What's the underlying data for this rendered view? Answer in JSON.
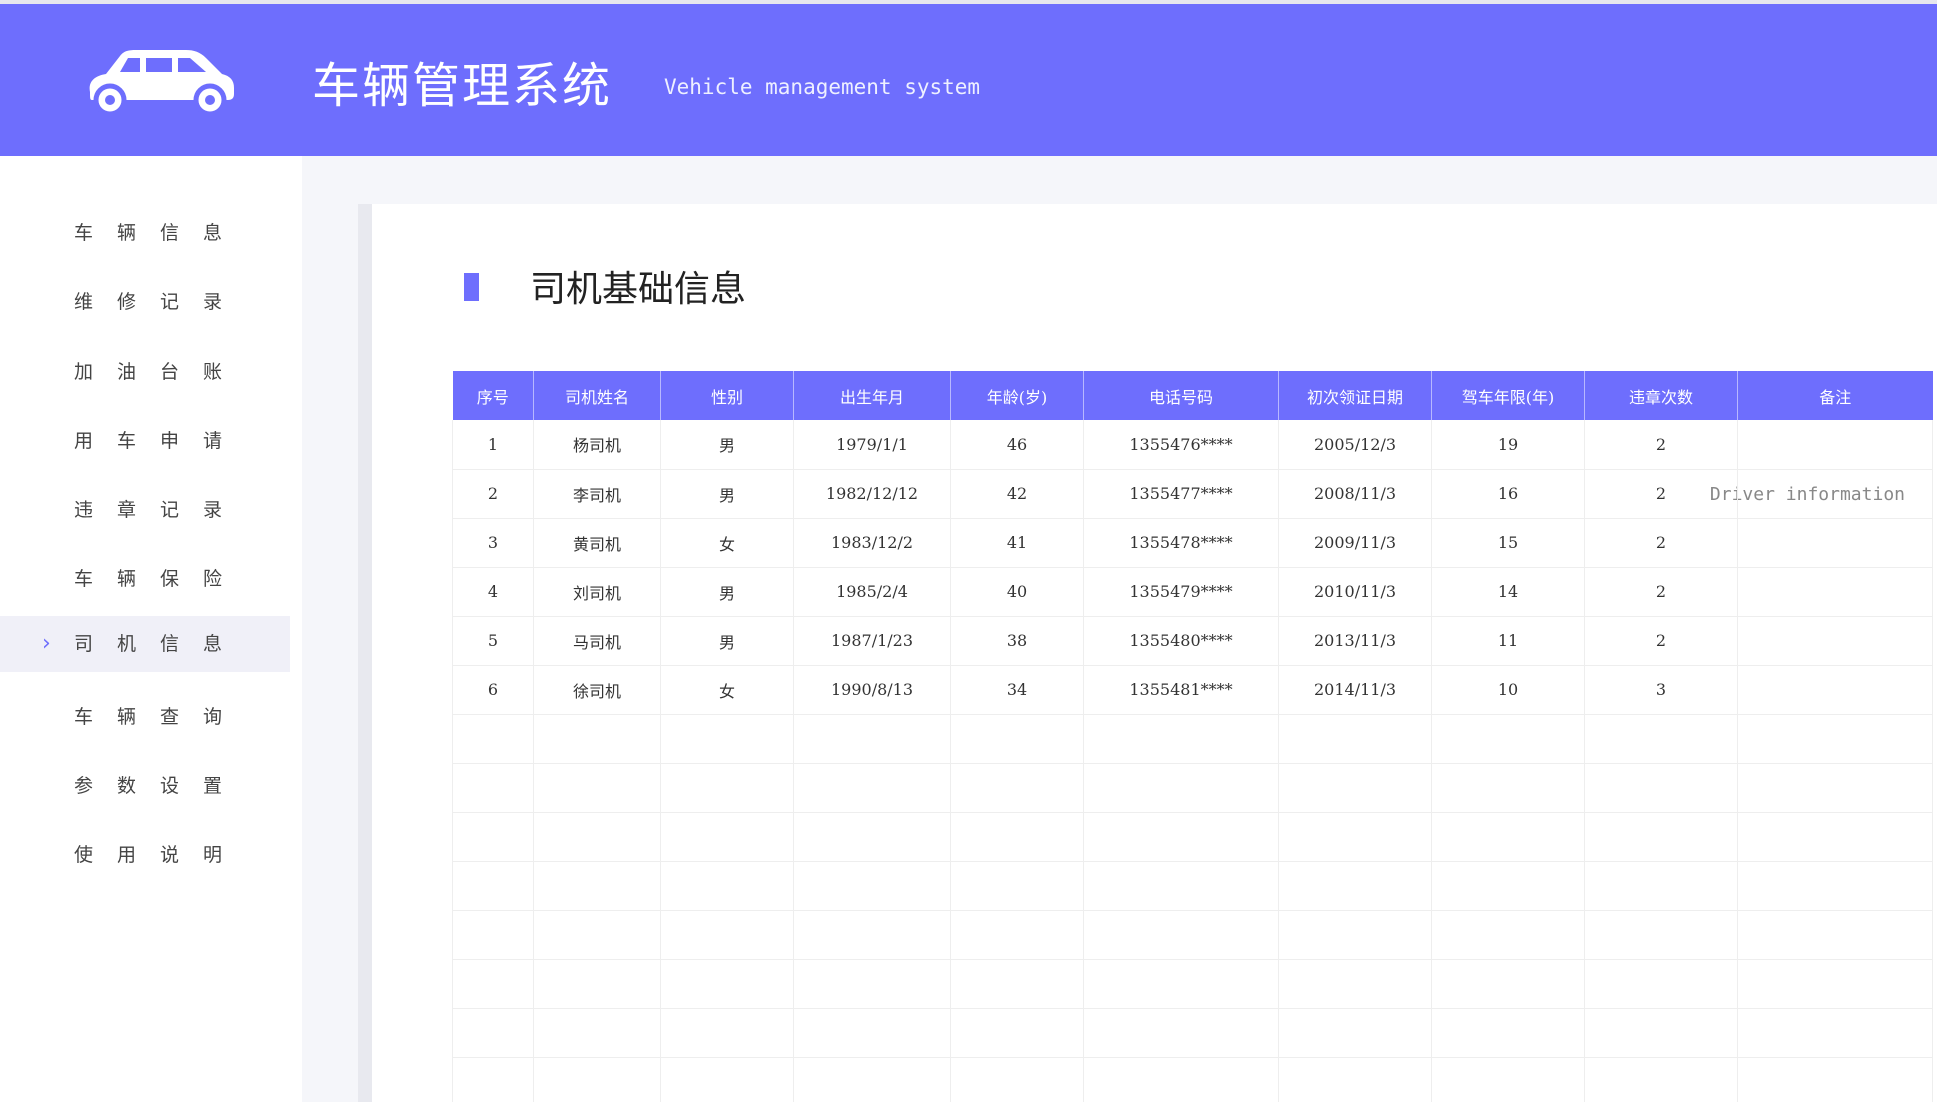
{
  "app": {
    "title": "车辆管理系统",
    "subtitle": "Vehicle management system"
  },
  "colors": {
    "brand": "#6e6efd",
    "page_bg": "#f5f6fa",
    "active_nav_bg": "#f0f0f8"
  },
  "icons": {
    "logo": "car-icon",
    "active_marker": "chevron-right-icon"
  },
  "sidebar": {
    "items": [
      {
        "label": "车辆信息",
        "active": false
      },
      {
        "label": "维修记录",
        "active": false
      },
      {
        "label": "加油台账",
        "active": false
      },
      {
        "label": "用车申请",
        "active": false
      },
      {
        "label": "违章记录",
        "active": false
      },
      {
        "label": "车辆保险",
        "active": false
      },
      {
        "label": "司机信息",
        "active": true
      },
      {
        "label": "车辆查询",
        "active": false
      },
      {
        "label": "参数设置",
        "active": false
      },
      {
        "label": "使用说明",
        "active": false
      }
    ],
    "active_chevron": "›"
  },
  "section": {
    "title": "司机基础信息",
    "title_en": "Driver information"
  },
  "table": {
    "headers": [
      "序号",
      "司机姓名",
      "性别",
      "出生年月",
      "年龄(岁)",
      "电话号码",
      "初次领证日期",
      "驾车年限(年)",
      "违章次数",
      "备注"
    ],
    "rows": [
      [
        "1",
        "杨司机",
        "男",
        "1979/1/1",
        "46",
        "1355476****",
        "2005/12/3",
        "19",
        "2",
        ""
      ],
      [
        "2",
        "李司机",
        "男",
        "1982/12/12",
        "42",
        "1355477****",
        "2008/11/3",
        "16",
        "2",
        ""
      ],
      [
        "3",
        "黄司机",
        "女",
        "1983/12/2",
        "41",
        "1355478****",
        "2009/11/3",
        "15",
        "2",
        ""
      ],
      [
        "4",
        "刘司机",
        "男",
        "1985/2/4",
        "40",
        "1355479****",
        "2010/11/3",
        "14",
        "2",
        ""
      ],
      [
        "5",
        "马司机",
        "男",
        "1987/1/23",
        "38",
        "1355480****",
        "2013/11/3",
        "11",
        "2",
        ""
      ],
      [
        "6",
        "徐司机",
        "女",
        "1990/8/13",
        "34",
        "1355481****",
        "2014/11/3",
        "10",
        "3",
        ""
      ]
    ]
  }
}
